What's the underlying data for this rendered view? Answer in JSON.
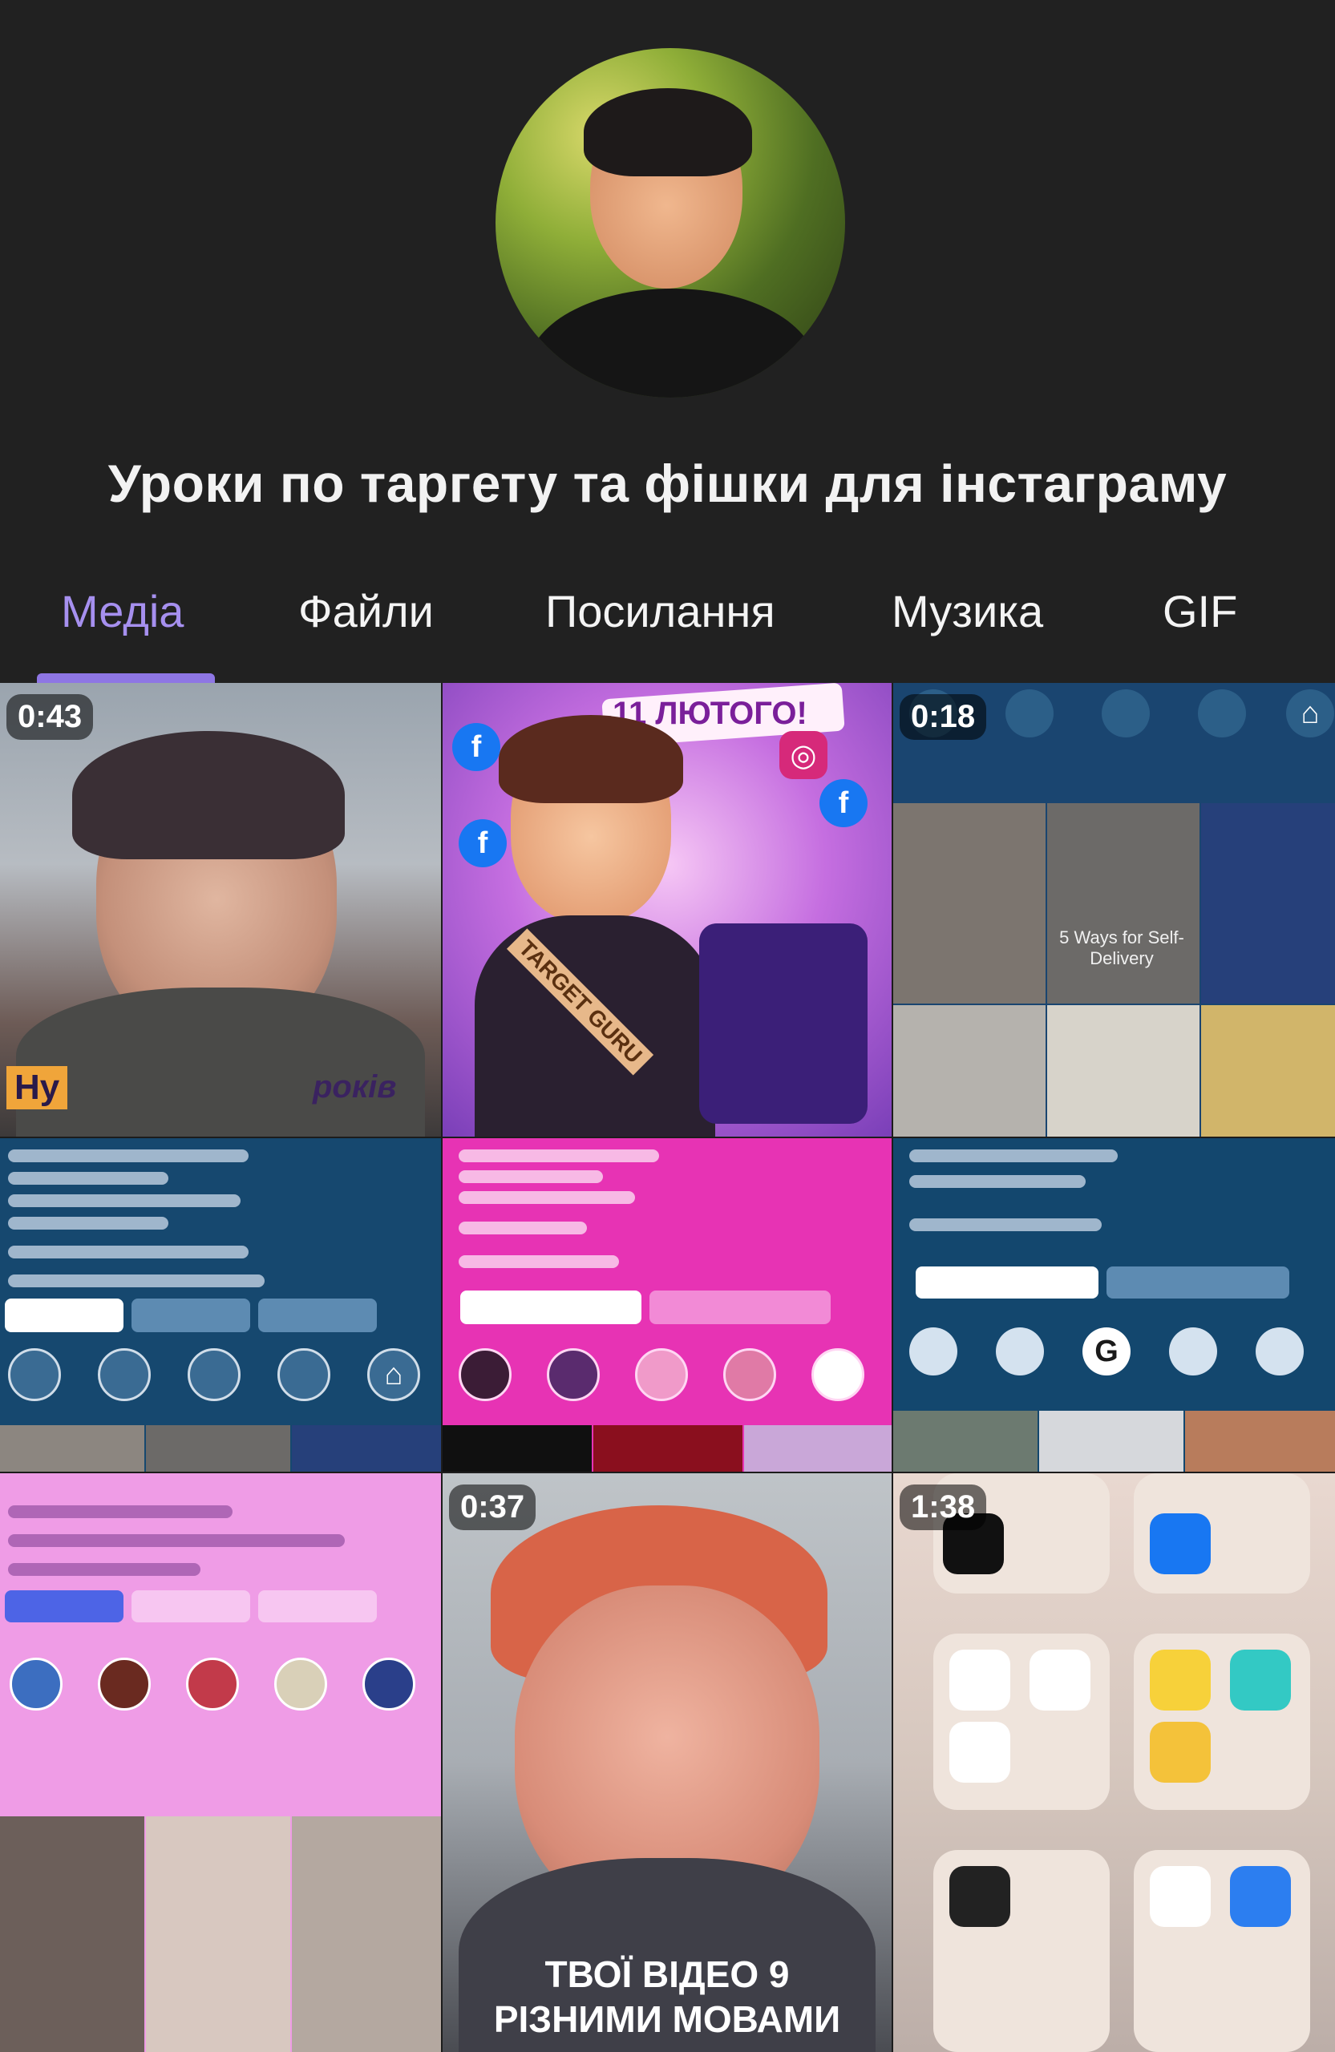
{
  "channel": {
    "title": "Уроки по таргету та фішки для інстаграму"
  },
  "tabs": [
    {
      "label": "Медіа",
      "active": true
    },
    {
      "label": "Файли",
      "active": false
    },
    {
      "label": "Посилання",
      "active": false
    },
    {
      "label": "Музика",
      "active": false
    },
    {
      "label": "GIF",
      "active": false
    }
  ],
  "media": {
    "items": [
      {
        "duration": "0:43",
        "caption_a": "Ну",
        "caption_b": "років"
      },
      {
        "banner": "11 ЛЮТОГО!",
        "sash": "TARGET GURU"
      },
      {
        "duration": "0:18",
        "note": "5 Ways for Self-Delivery"
      },
      {},
      {},
      {},
      {},
      {
        "duration": "0:37",
        "caption_line1": "ТВОЇ ВІДЕО 9",
        "caption_line2": "РІЗНИМИ МОВАМИ"
      },
      {
        "duration": "1:38"
      }
    ]
  },
  "colors": {
    "background": "#212121",
    "active_tab": "#a690ef",
    "tab_indicator": "#8e76e4",
    "pink": "#e733b4",
    "navy": "#13476e",
    "lilac": "#ef9ce6"
  }
}
